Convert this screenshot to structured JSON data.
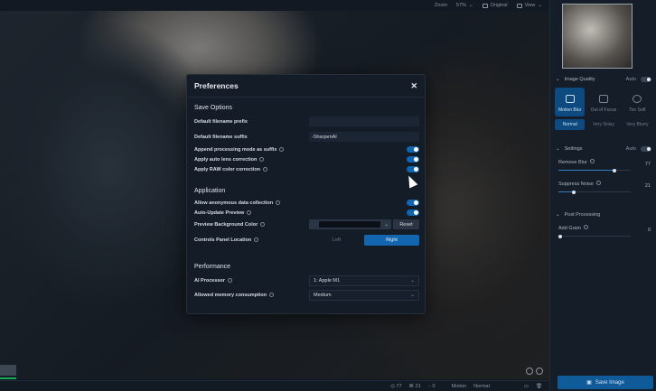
{
  "topbar": {
    "zoom_label": "Zoom",
    "zoom_value": "57%",
    "original_label": "Original",
    "view_label": "View"
  },
  "panel": {
    "image_quality": {
      "title": "Image Quality",
      "auto_label": "Auto",
      "modes": [
        "Motion Blur",
        "Out of Focus",
        "Too Soft"
      ],
      "selected_mode": "Motion Blur",
      "noise_options": [
        "Normal",
        "Very Noisy",
        "Very Blurry"
      ],
      "selected_noise": "Normal"
    },
    "settings": {
      "title": "Settings",
      "auto_label": "Auto",
      "sliders": [
        {
          "label": "Remove Blur",
          "value": 77
        },
        {
          "label": "Suppress Noise",
          "value": 21
        }
      ]
    },
    "post_processing": {
      "title": "Post Processing",
      "sliders": [
        {
          "label": "Add Grain",
          "value": 0
        }
      ]
    },
    "save_label": "Save Image"
  },
  "status": {
    "blur": "77",
    "noise": "21",
    "grain": "0",
    "mode": "Motion",
    "noise_mode": "Normal"
  },
  "modal": {
    "title": "Preferences",
    "save_options": {
      "heading": "Save Options",
      "prefix_label": "Default filename prefix",
      "prefix_value": "",
      "suffix_label": "Default filename suffix",
      "suffix_value": "-SharpenAI",
      "append_label": "Append processing mode as suffix",
      "append_on": true,
      "lens_label": "Apply auto lens correction",
      "lens_on": true,
      "raw_label": "Apply RAW color correction",
      "raw_on": true
    },
    "application": {
      "heading": "Application",
      "anon_label": "Allow anonymous data collection",
      "anon_on": true,
      "autoupdate_label": "Auto-Update Preview",
      "autoupdate_on": true,
      "bg_label": "Preview Background Color",
      "bg_color": "#0b1017",
      "reset_label": "Reset",
      "location_label": "Controls Panel Location",
      "location_options": [
        "Left",
        "Right"
      ],
      "location_selected": "Right"
    },
    "performance": {
      "heading": "Performance",
      "processor_label": "AI Processor",
      "processor_value": "1: Apple M1",
      "memory_label": "Allowed memory consumption",
      "memory_value": "Medium"
    }
  },
  "colors": {
    "accent": "#1266b0",
    "panel": "#151d28",
    "modal": "#141c28"
  }
}
